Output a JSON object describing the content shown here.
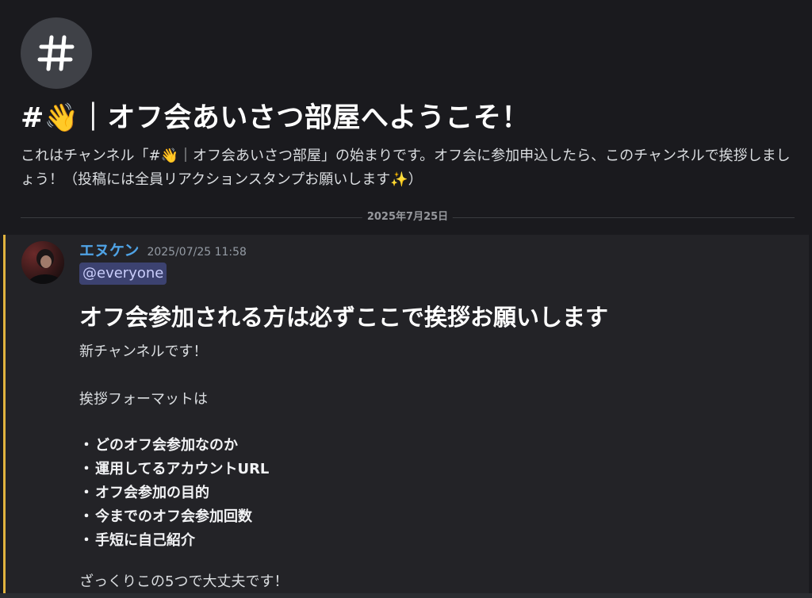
{
  "channel": {
    "icon": "hash-icon",
    "welcome_title": "#👋｜オフ会あいさつ部屋へようこそ！",
    "description": "これはチャンネル「#👋｜オフ会あいさつ部屋」の始まりです。オフ会に参加申込したら、このチャンネルで挨拶しましょう！（投稿には全員リアクションスタンプお願いします✨）"
  },
  "divider": {
    "date": "2025年7月25日"
  },
  "message": {
    "author": "エヌケン",
    "author_color": "#4fa3e6",
    "timestamp": "2025/07/25 11:58",
    "mention": "@everyone",
    "heading": "オフ会参加される方は必ずここで挨拶お願いします",
    "line1": "新チャンネルです！",
    "line2": "挨拶フォーマットは",
    "bullet_char": "・",
    "bullets": [
      "どのオフ会参加なのか",
      "運用してるアカウントURL",
      "オフ会参加の目的",
      "今までのオフ会参加回数",
      "手短に自己紹介"
    ],
    "closing": "ざっくりこの5つで大丈夫です！"
  },
  "colors": {
    "background": "#1a1a1e",
    "message_highlight": "#232327",
    "highlight_border": "#e0b33f",
    "mention_bg": "#3c4270"
  }
}
